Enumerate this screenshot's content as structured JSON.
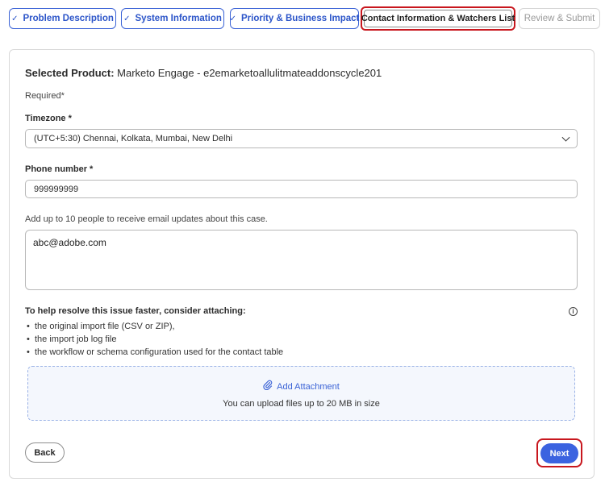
{
  "steps": [
    {
      "label": "Problem Description",
      "check": "✓"
    },
    {
      "label": "System Information",
      "check": "✓"
    },
    {
      "label": "Priority & Business Impact",
      "check": "✓"
    },
    {
      "label": "Contact Information & Watchers List"
    },
    {
      "label": "Review & Submit"
    }
  ],
  "form": {
    "product_label": "Selected Product:",
    "product_value": "Marketo Engage - e2emarketoallulitmateaddonscycle201",
    "required_note": "Required*",
    "timezone_label": "Timezone *",
    "timezone_value": "(UTC+5:30) Chennai, Kolkata, Mumbai, New Delhi",
    "phone_label": "Phone number *",
    "phone_value": "999999999",
    "watchers_helper": "Add up to 10 people to receive email updates about this case.",
    "watchers_value": "abc@adobe.com"
  },
  "tips": {
    "title": "To help resolve this issue faster, consider attaching:",
    "info_icon": "i",
    "items": [
      "the original import file (CSV or ZIP),",
      "the import job log file",
      "the workflow or schema configuration used for the contact table"
    ]
  },
  "attachment": {
    "label": "Add Attachment",
    "limit_text": "You can upload files up to 20 MB in size"
  },
  "actions": {
    "back_label": "Back",
    "next_label": "Next"
  },
  "colors": {
    "accent": "#3b63e0",
    "highlight_border": "#c8171e"
  }
}
